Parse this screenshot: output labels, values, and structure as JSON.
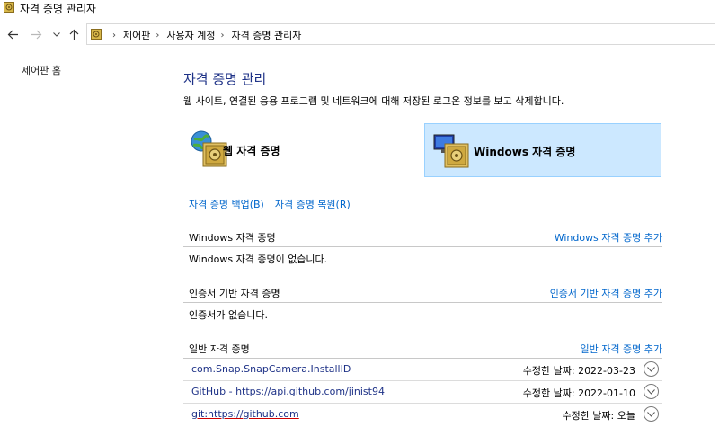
{
  "window": {
    "title": "자격 증명 관리자"
  },
  "navigation": {
    "back_icon": "arrow-left-icon",
    "forward_icon": "arrow-right-icon",
    "recent_icon": "chevron-down-icon",
    "up_icon": "arrow-up-icon"
  },
  "address": {
    "crumbs": [
      "제어판",
      "사용자 계정",
      "자격 증명 관리자"
    ]
  },
  "sidebar": {
    "home_label": "제어판 홈"
  },
  "main": {
    "heading": "자격 증명 관리",
    "subtitle": "웹 사이트, 연결된 응용 프로그램 및 네트워크에 대해 저장된 로그온 정보를 보고 삭제합니다.",
    "tiles": {
      "web_label": "웹 자격 증명",
      "windows_label": "Windows 자격 증명"
    },
    "backup_link": "자격 증명 백업(B)",
    "restore_link": "자격 증명 복원(R)",
    "sections": {
      "windows": {
        "title": "Windows 자격 증명",
        "add_link": "Windows 자격 증명 추가",
        "empty_text": "Windows 자격 증명이 없습니다."
      },
      "certificate": {
        "title": "인증서 기반 자격 증명",
        "add_link": "인증서 기반 자격 증명 추가",
        "empty_text": "인증서가 없습니다."
      },
      "generic": {
        "title": "일반 자격 증명",
        "add_link": "일반 자격 증명 추가",
        "items": [
          {
            "name": "com.Snap.SnapCamera.InstallID",
            "modified": "수정한 날짜:  2022-03-23"
          },
          {
            "name": "GitHub - https://api.github.com/jinist94",
            "modified": "수정한 날짜:  2022-01-10"
          },
          {
            "name": "git:https://github.com",
            "modified": "수정한 날짜:  오늘"
          }
        ]
      }
    }
  },
  "colors": {
    "link": "#0066cc",
    "heading": "#1e3287",
    "selected_tile_bg": "#cce8ff",
    "selected_tile_border": "#99d1ff"
  }
}
